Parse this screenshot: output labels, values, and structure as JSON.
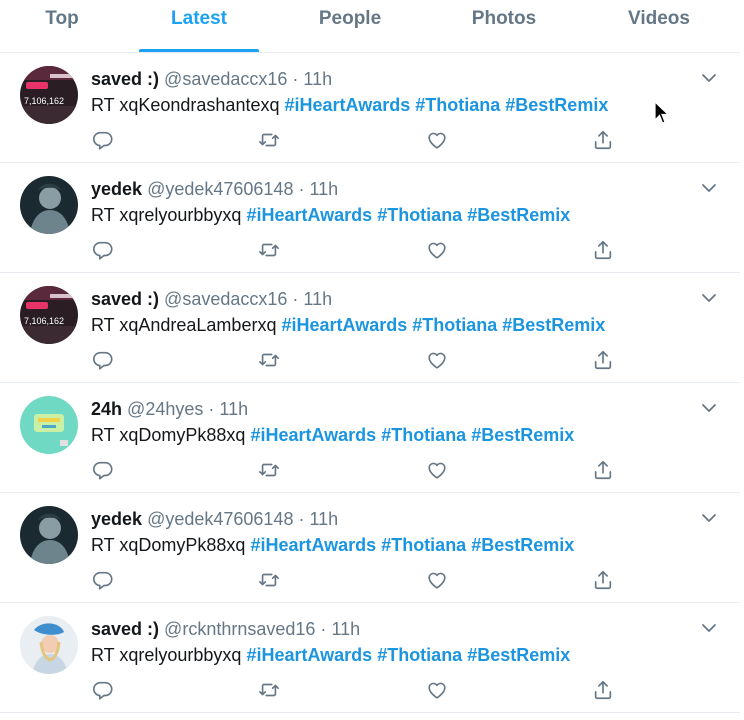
{
  "tabs": [
    {
      "label": "Top",
      "active": false
    },
    {
      "label": "Latest",
      "active": true
    },
    {
      "label": "People",
      "active": false
    },
    {
      "label": "Photos",
      "active": false
    },
    {
      "label": "Videos",
      "active": false
    }
  ],
  "separator": "·",
  "tweets": [
    {
      "name": "saved :)",
      "handle": "@savedaccx16",
      "time": "11h",
      "rt": "RT",
      "user": "xqKeondrashantexq",
      "tags": [
        "#iHeartAwards",
        "#Thotiana",
        "#BestRemix"
      ],
      "avatar": "dark-pink",
      "avatar_text": "7,106,162"
    },
    {
      "name": "yedek",
      "handle": "@yedek47606148",
      "time": "11h",
      "rt": "RT",
      "user": "xqrelyourbbyxq",
      "tags": [
        "#iHeartAwards",
        "#Thotiana",
        "#BestRemix"
      ],
      "avatar": "dark-person",
      "avatar_text": ""
    },
    {
      "name": "saved :)",
      "handle": "@savedaccx16",
      "time": "11h",
      "rt": "RT",
      "user": "xqAndreaLamberxq",
      "tags": [
        "#iHeartAwards",
        "#Thotiana",
        "#BestRemix"
      ],
      "avatar": "dark-pink",
      "avatar_text": "7,106,162"
    },
    {
      "name": "24h",
      "handle": "@24hyes",
      "time": "11h",
      "rt": "RT",
      "user": "xqDomyPk88xq",
      "tags": [
        "#iHeartAwards",
        "#Thotiana",
        "#BestRemix"
      ],
      "avatar": "teal",
      "avatar_text": ""
    },
    {
      "name": "yedek",
      "handle": "@yedek47606148",
      "time": "11h",
      "rt": "RT",
      "user": "xqDomyPk88xq",
      "tags": [
        "#iHeartAwards",
        "#Thotiana",
        "#BestRemix"
      ],
      "avatar": "dark-person",
      "avatar_text": ""
    },
    {
      "name": "saved :)",
      "handle": "@rcknthrnsaved16",
      "time": "11h",
      "rt": "RT",
      "user": "xqrelyourbbyxq",
      "tags": [
        "#iHeartAwards",
        "#Thotiana",
        "#BestRemix"
      ],
      "avatar": "light-person",
      "avatar_text": ""
    }
  ],
  "colors": {
    "accent": "#1da1f2",
    "hashtag": "#1b95e0",
    "muted": "#657786",
    "text": "#14171a"
  },
  "icons": {
    "reply": "reply-icon",
    "retweet": "retweet-icon",
    "like": "heart-icon",
    "share": "share-icon",
    "menu": "chevron-down-icon"
  }
}
